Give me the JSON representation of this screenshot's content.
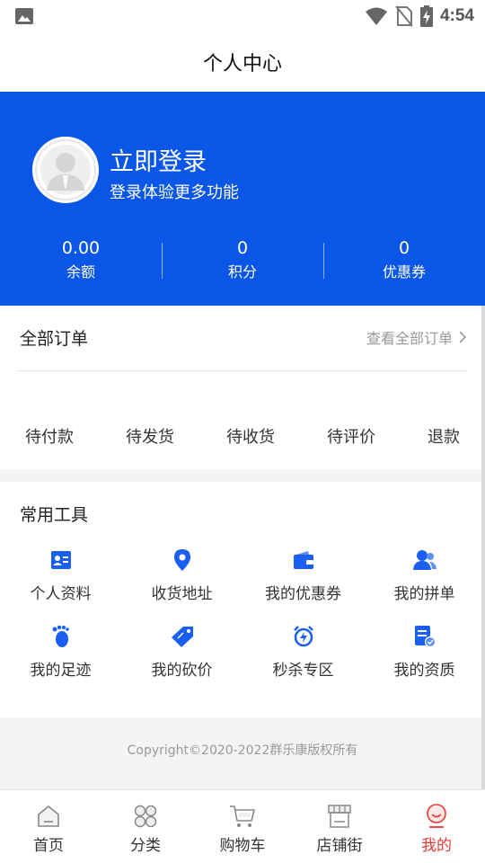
{
  "status_bar": {
    "time": "4:54",
    "icons": [
      "image-icon",
      "wifi-icon",
      "no-sim-icon",
      "battery-charging-icon"
    ]
  },
  "header": {
    "title": "个人中心"
  },
  "profile": {
    "login_title": "立即登录",
    "login_subtitle": "登录体验更多功能",
    "stats": [
      {
        "value": "0.00",
        "label": "余额"
      },
      {
        "value": "0",
        "label": "积分"
      },
      {
        "value": "0",
        "label": "优惠券"
      }
    ],
    "background_color": "#0a56e6"
  },
  "orders": {
    "title": "全部订单",
    "view_all": "查看全部订单",
    "items": [
      "待付款",
      "待发货",
      "待收货",
      "待评价",
      "退款"
    ]
  },
  "tools": {
    "title": "常用工具",
    "items": [
      {
        "label": "个人资料",
        "icon": "id-card-icon"
      },
      {
        "label": "收货地址",
        "icon": "location-pin-icon"
      },
      {
        "label": "我的优惠券",
        "icon": "wallet-icon"
      },
      {
        "label": "我的拼单",
        "icon": "group-users-icon"
      },
      {
        "label": "我的足迹",
        "icon": "footprint-icon"
      },
      {
        "label": "我的砍价",
        "icon": "price-tag-icon"
      },
      {
        "label": "秒杀专区",
        "icon": "alarm-clock-icon"
      },
      {
        "label": "我的资质",
        "icon": "certificate-icon"
      }
    ],
    "icon_color": "#1a5ff0"
  },
  "footer": {
    "copyright": "Copyright©2020-2022群乐康版权所有"
  },
  "tabbar": {
    "items": [
      {
        "label": "首页",
        "icon": "home-icon"
      },
      {
        "label": "分类",
        "icon": "category-grid-icon"
      },
      {
        "label": "购物车",
        "icon": "cart-icon"
      },
      {
        "label": "店铺街",
        "icon": "storefront-icon"
      },
      {
        "label": "我的",
        "icon": "profile-icon",
        "active": true
      }
    ],
    "active_color": "#e53935"
  }
}
